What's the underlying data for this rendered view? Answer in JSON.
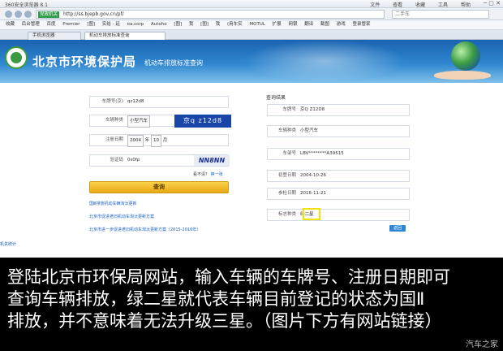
{
  "browser": {
    "title": "360安全浏览器 8.1",
    "menus": [
      "文件",
      "查看",
      "收藏",
      "工具",
      "帮助"
    ],
    "url_tag": "党政机关",
    "url": "http://ss.bjepb.gov.cn/pf/",
    "search_text": "二手车",
    "bookmarks": [
      "收藏",
      "后台管理",
      "百度",
      "Premier",
      "[图]",
      "实给 - 延",
      "oa.corp",
      "Autoho",
      "[图]",
      "我",
      "[图]",
      "我",
      "(用车实",
      "MOTUL",
      "扩展",
      "网银",
      "翻译",
      "截图",
      "游戏",
      "登录管家"
    ],
    "tabs": [
      "手机浏览器",
      "机动车排放标准查询"
    ]
  },
  "header": {
    "bureau_name": "北京市环境保护局",
    "site_title": "机动车排放标准查询"
  },
  "form": {
    "plate_label": "车牌号(京)",
    "plate_value": "qz12d8",
    "plate_display": "京q z12d8",
    "vehicle_type_label": "车辆种类",
    "vehicle_type_value": "小型汽车",
    "reg_date_label": "注册日期",
    "reg_year": "2004",
    "year_unit": "年",
    "reg_month": "10",
    "month_unit": "月",
    "captcha_label": "验证码",
    "captcha_value": "0s0fp",
    "captcha_image_text": "NN8NN",
    "refresh_prompt": "看不清？",
    "refresh_link": "换一张",
    "query_button": "查询"
  },
  "links": [
    "国Ⅲ排放机动车辆淘汰更新",
    "北京市促进老旧机动车淘汰更新方案",
    "北京市进一步促进老旧机动车淘汰更新方案（2015-2016年）"
  ],
  "left_link": "机关统计",
  "result": {
    "title": "查询结果",
    "rows": [
      {
        "label": "车牌号",
        "value": "京Q Z12D8"
      },
      {
        "label": "车辆种类",
        "value": "小型汽车"
      },
      {
        "label": "车架号",
        "value": "LBV********A39515"
      },
      {
        "label": "初登日期",
        "value": "2004-10-26"
      },
      {
        "label": "参检日期",
        "value": "2016-11-21"
      },
      {
        "label": "标志种类",
        "value": "绿二星"
      }
    ],
    "back_button": "返回"
  },
  "caption": {
    "lines": [
      "登陆北京市环保局网站，输入车辆的车牌号、注册日期即可",
      "查询车辆排放，绿二星就代表车辆目前登记的状态为国Ⅱ",
      "排放，并不意味着无法升级三星。（图片下方有网站链接）"
    ],
    "watermark": "汽车之家"
  }
}
